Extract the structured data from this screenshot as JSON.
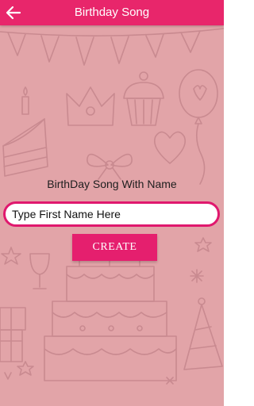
{
  "app_bar": {
    "title": "Birthday Song",
    "back_icon": "arrow-left-icon",
    "color": "#e8266b"
  },
  "form": {
    "heading": "BirthDay Song With Name",
    "name_input": {
      "value": "",
      "placeholder": "Type First Name Here"
    },
    "create_label": "CREATE",
    "accent": "#e51f6e"
  },
  "background": {
    "color": "#e2a4a8",
    "pattern_icons": [
      "bunting-icon",
      "candle-icon",
      "crown-icon",
      "cupcake-icon",
      "balloon-icon",
      "cake-slice-icon",
      "heart-icon",
      "bow-icon",
      "star-icon",
      "glass-icon",
      "birthday-cake-icon",
      "gift-icon",
      "party-hat-icon",
      "confetti-icon"
    ]
  }
}
